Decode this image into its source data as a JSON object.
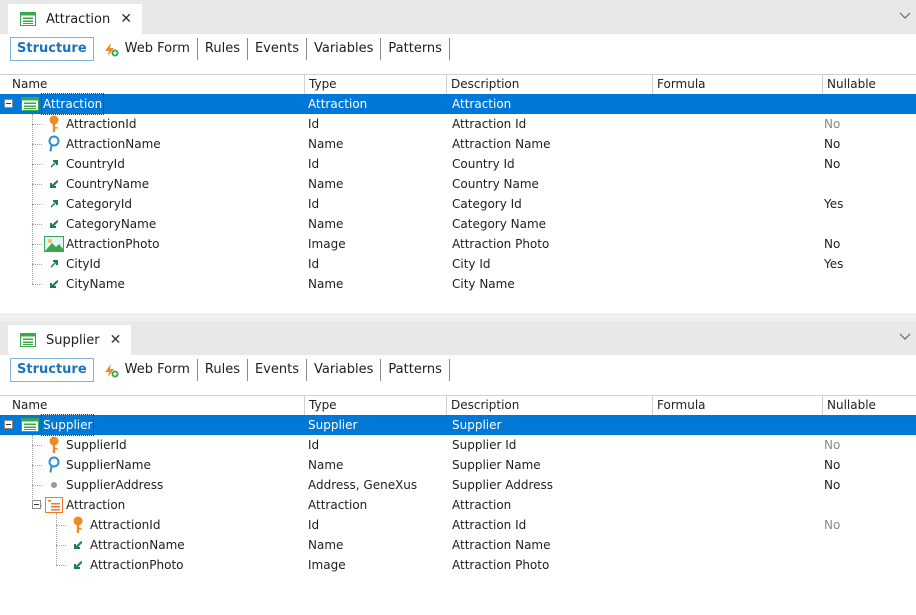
{
  "columns": {
    "name": "Name",
    "type": "Type",
    "description": "Description",
    "formula": "Formula",
    "nullable": "Nullable"
  },
  "toolbar": {
    "structure": "Structure",
    "web_form": "Web Form",
    "rules": "Rules",
    "events": "Events",
    "variables": "Variables",
    "patterns": "Patterns"
  },
  "panel1": {
    "tab_title": "Attraction",
    "close": "✕",
    "rows": [
      {
        "name": "Attraction",
        "type": "Attraction",
        "description": "Attraction",
        "formula": "",
        "nullable": "",
        "icon": "transaction-icon"
      },
      {
        "name": "AttractionId",
        "type": "Id",
        "description": "Attraction Id",
        "formula": "",
        "nullable": "No",
        "icon": "primary-key-icon"
      },
      {
        "name": "AttractionName",
        "type": "Name",
        "description": "Attraction Name",
        "formula": "",
        "nullable": "No",
        "icon": "description-attribute-icon"
      },
      {
        "name": "CountryId",
        "type": "Id",
        "description": "Country Id",
        "formula": "",
        "nullable": "No",
        "icon": "foreign-key-icon"
      },
      {
        "name": "CountryName",
        "type": "Name",
        "description": "Country Name",
        "formula": "",
        "nullable": "",
        "icon": "inferred-attribute-icon"
      },
      {
        "name": "CategoryId",
        "type": "Id",
        "description": "Category Id",
        "formula": "",
        "nullable": "Yes",
        "icon": "foreign-key-icon"
      },
      {
        "name": "CategoryName",
        "type": "Name",
        "description": "Category Name",
        "formula": "",
        "nullable": "",
        "icon": "inferred-attribute-icon"
      },
      {
        "name": "AttractionPhoto",
        "type": "Image",
        "description": "Attraction Photo",
        "formula": "",
        "nullable": "No",
        "icon": "image-icon"
      },
      {
        "name": "CityId",
        "type": "Id",
        "description": "City Id",
        "formula": "",
        "nullable": "Yes",
        "icon": "foreign-key-icon"
      },
      {
        "name": "CityName",
        "type": "Name",
        "description": "City Name",
        "formula": "",
        "nullable": "",
        "icon": "inferred-attribute-icon"
      }
    ]
  },
  "panel2": {
    "tab_title": "Supplier",
    "close": "✕",
    "rows": [
      {
        "name": "Supplier",
        "type": "Supplier",
        "description": "Supplier",
        "formula": "",
        "nullable": "",
        "icon": "transaction-icon"
      },
      {
        "name": "SupplierId",
        "type": "Id",
        "description": "Supplier Id",
        "formula": "",
        "nullable": "No",
        "icon": "primary-key-icon"
      },
      {
        "name": "SupplierName",
        "type": "Name",
        "description": "Supplier Name",
        "formula": "",
        "nullable": "No",
        "icon": "description-attribute-icon"
      },
      {
        "name": "SupplierAddress",
        "type": "Address, GeneXus",
        "description": "Supplier Address",
        "formula": "",
        "nullable": "No",
        "icon": "attribute-dot-icon"
      },
      {
        "name": "Attraction",
        "type": "Attraction",
        "description": "Attraction",
        "formula": "",
        "nullable": "",
        "icon": "sublevel-icon"
      },
      {
        "name": "AttractionId",
        "type": "Id",
        "description": "Attraction Id",
        "formula": "",
        "nullable": "No",
        "icon": "primary-key-icon"
      },
      {
        "name": "AttractionName",
        "type": "Name",
        "description": "Attraction Name",
        "formula": "",
        "nullable": "",
        "icon": "inferred-attribute-icon"
      },
      {
        "name": "AttractionPhoto",
        "type": "Image",
        "description": "Attraction Photo",
        "formula": "",
        "nullable": "",
        "icon": "inferred-attribute-icon"
      }
    ]
  },
  "colors": {
    "selection": "#0078d7",
    "structure_active": "#1c74bd",
    "key_icon": "#f08a24",
    "description_icon": "#2a8fd4",
    "fk_arrow": "#1a7f4e",
    "transaction_icon": "#3aa84a",
    "sublevel_icon": "#f07a2a"
  }
}
